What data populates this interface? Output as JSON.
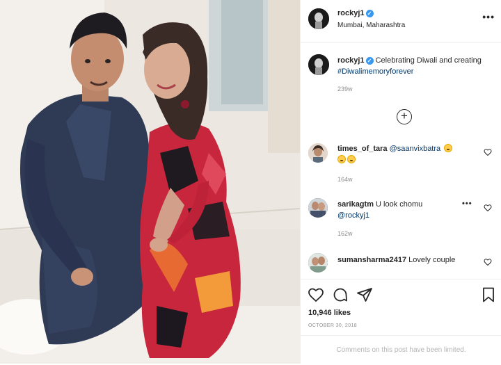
{
  "post": {
    "author": "rockyj1",
    "location": "Mumbai, Maharashtra",
    "more_label": "•••"
  },
  "caption": {
    "username": "rockyj1",
    "text": "Celebrating Diwali and creating",
    "hashtag": "#Diwalimemoryforever",
    "age": "239w"
  },
  "load_more_label": "+",
  "comments": [
    {
      "username": "times_of_tara",
      "text": "@saanvixbatra",
      "age": "164w"
    },
    {
      "username": "sarikagtm",
      "text": "U look chomu",
      "mention": "@rockyj1",
      "age": "162w"
    },
    {
      "username": "sumansharma2417",
      "text": "Lovely couple",
      "age": ""
    }
  ],
  "likes": "10,946 likes",
  "date": "OCTOBER 30, 2018",
  "comments_limited": "Comments on this post have been limited.",
  "icons": [
    "heart-icon",
    "comment-icon",
    "share-icon",
    "bookmark-icon",
    "verified-badge-icon",
    "more-options-icon",
    "add-circle-icon"
  ],
  "colors": {
    "link": "#00376b",
    "verified": "#3897f0",
    "muted": "#8e8e8e"
  }
}
